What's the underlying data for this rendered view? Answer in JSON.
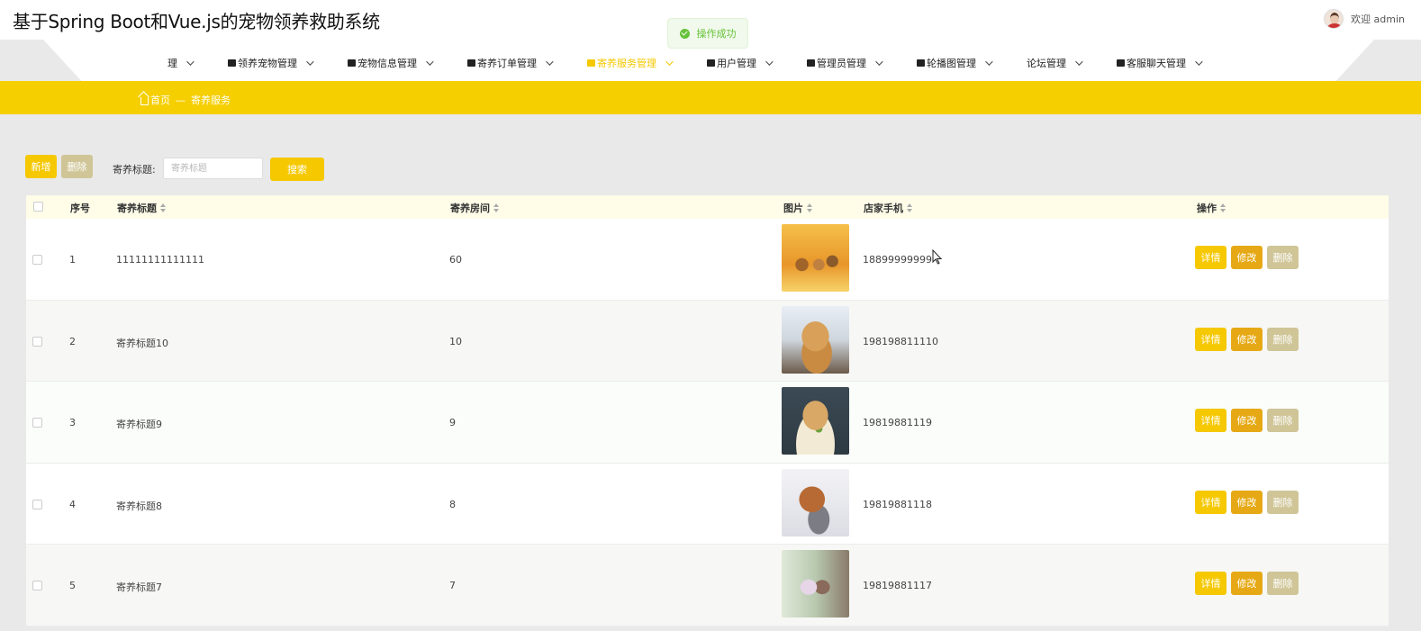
{
  "header": {
    "title": "基于Spring Boot和Vue.js的宠物领养救助系统",
    "user_text": "欢迎 admin"
  },
  "toast": {
    "message": "操作成功"
  },
  "nav": {
    "items": [
      {
        "label": "理"
      },
      {
        "label": "领养宠物管理"
      },
      {
        "label": "宠物信息管理"
      },
      {
        "label": "寄养订单管理"
      },
      {
        "label": "寄养服务管理",
        "active": true
      },
      {
        "label": "用户管理"
      },
      {
        "label": "管理员管理"
      },
      {
        "label": "轮播图管理"
      },
      {
        "label": "论坛管理"
      },
      {
        "label": "客服聊天管理"
      }
    ]
  },
  "breadcrumb": {
    "home": "首页",
    "separator": "—",
    "current": "寄养服务"
  },
  "toolbar": {
    "add_label": "新增",
    "delete_label": "删除",
    "search_label": "寄养标题:",
    "search_placeholder": "寄养标题",
    "search_button": "搜索"
  },
  "table": {
    "columns": [
      "序号",
      "寄养标题",
      "寄养房间",
      "图片",
      "店家手机",
      "操作"
    ],
    "actions": {
      "detail": "详情",
      "edit": "修改",
      "delete": "删除"
    },
    "rows": [
      {
        "index": "1",
        "title": "11111111111111",
        "room": "60",
        "phone": "18899999999",
        "image": "hamsters-photo"
      },
      {
        "index": "2",
        "title": "寄养标题10",
        "room": "10",
        "phone": "198198811110",
        "image": "golden-retriever-photo"
      },
      {
        "index": "3",
        "title": "寄养标题9",
        "room": "9",
        "phone": "19819881119",
        "image": "hamster-photo"
      },
      {
        "index": "4",
        "title": "寄养标题8",
        "room": "8",
        "phone": "19819881118",
        "image": "dog-and-cat-photo"
      },
      {
        "index": "5",
        "title": "寄养标题7",
        "room": "7",
        "phone": "19819881117",
        "image": "kids-window-photo"
      }
    ]
  },
  "colors": {
    "accent": "#f5c800",
    "edit": "#e6a915",
    "muted_button": "#cfc597",
    "header_row": "#fffde8",
    "success": "#67c23a"
  }
}
